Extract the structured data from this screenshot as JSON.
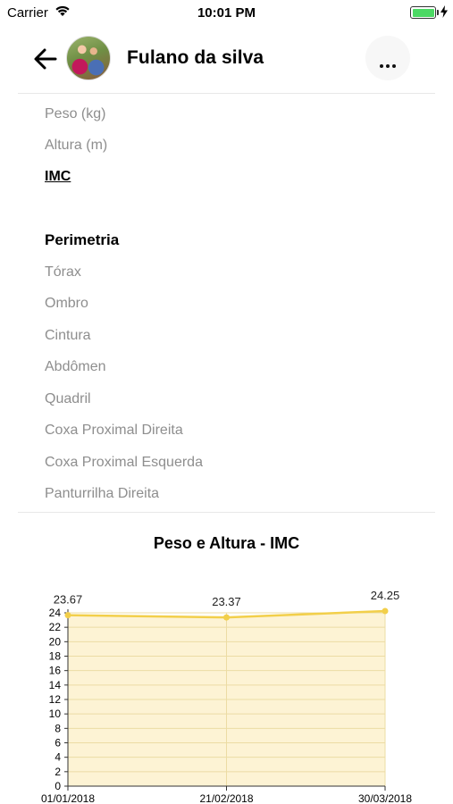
{
  "status_bar": {
    "carrier": "Carrier",
    "time": "10:01 PM",
    "battery_level": 1.0
  },
  "header": {
    "back_icon": "arrow-left-icon",
    "user_name": "Fulano da silva",
    "more_icon": "more-horizontal-icon"
  },
  "list": {
    "items": [
      {
        "label": "Peso (kg)",
        "active": false
      },
      {
        "label": "Altura (m)",
        "active": false
      },
      {
        "label": "IMC",
        "active": true
      }
    ],
    "section_title": "Perimetria",
    "perimetria_items": [
      "Tórax",
      "Ombro",
      "Cintura",
      "Abdômen",
      "Quadril",
      "Coxa Proximal Direita",
      "Coxa Proximal Esquerda",
      "Panturrilha Direita"
    ]
  },
  "chart_data": {
    "type": "area",
    "title": "Peso e Altura - IMC",
    "x": [
      "01/01/2018",
      "21/02/2018",
      "30/03/2018"
    ],
    "values": [
      23.67,
      23.37,
      24.25
    ],
    "data_labels": [
      "23.67",
      "23.37",
      "24.25"
    ],
    "ylim": [
      0,
      24
    ],
    "yticks": [
      0,
      2,
      4,
      6,
      8,
      10,
      12,
      14,
      16,
      18,
      20,
      22,
      24
    ],
    "grid": true,
    "line_color": "#f2cf4a",
    "fill_color": "#fdf3d4"
  }
}
